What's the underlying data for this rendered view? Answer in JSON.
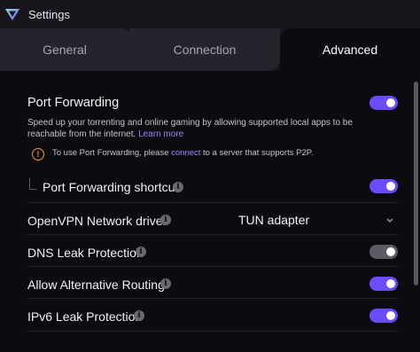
{
  "window": {
    "title": "Settings",
    "logo": "protonvpn-logo"
  },
  "tabs": [
    {
      "label": "General",
      "active": false
    },
    {
      "label": "Connection",
      "active": false
    },
    {
      "label": "Advanced",
      "active": true
    }
  ],
  "colors": {
    "accent": "#6d4aff",
    "warning": "#f29b36",
    "link": "#9c86ff"
  },
  "port_forwarding": {
    "label": "Port Forwarding",
    "enabled": true,
    "description": "Speed up your torrenting and online gaming by allowing supported local apps to be reachable from the internet.",
    "learn_more": "Learn more",
    "warning_prefix": "To use Port Forwarding, please ",
    "warning_link": "connect",
    "warning_suffix": " to a server that supports P2P."
  },
  "port_forwarding_shortcut": {
    "label": "Port Forwarding shortcut",
    "enabled": true
  },
  "openvpn_driver": {
    "label": "OpenVPN Network driver",
    "value": "TUN adapter"
  },
  "dns_leak": {
    "label": "DNS Leak Protection",
    "enabled": false
  },
  "alt_routing": {
    "label": "Allow Alternative Routing",
    "enabled": true
  },
  "ipv6_leak": {
    "label": "IPv6 Leak Protection",
    "enabled": true
  }
}
